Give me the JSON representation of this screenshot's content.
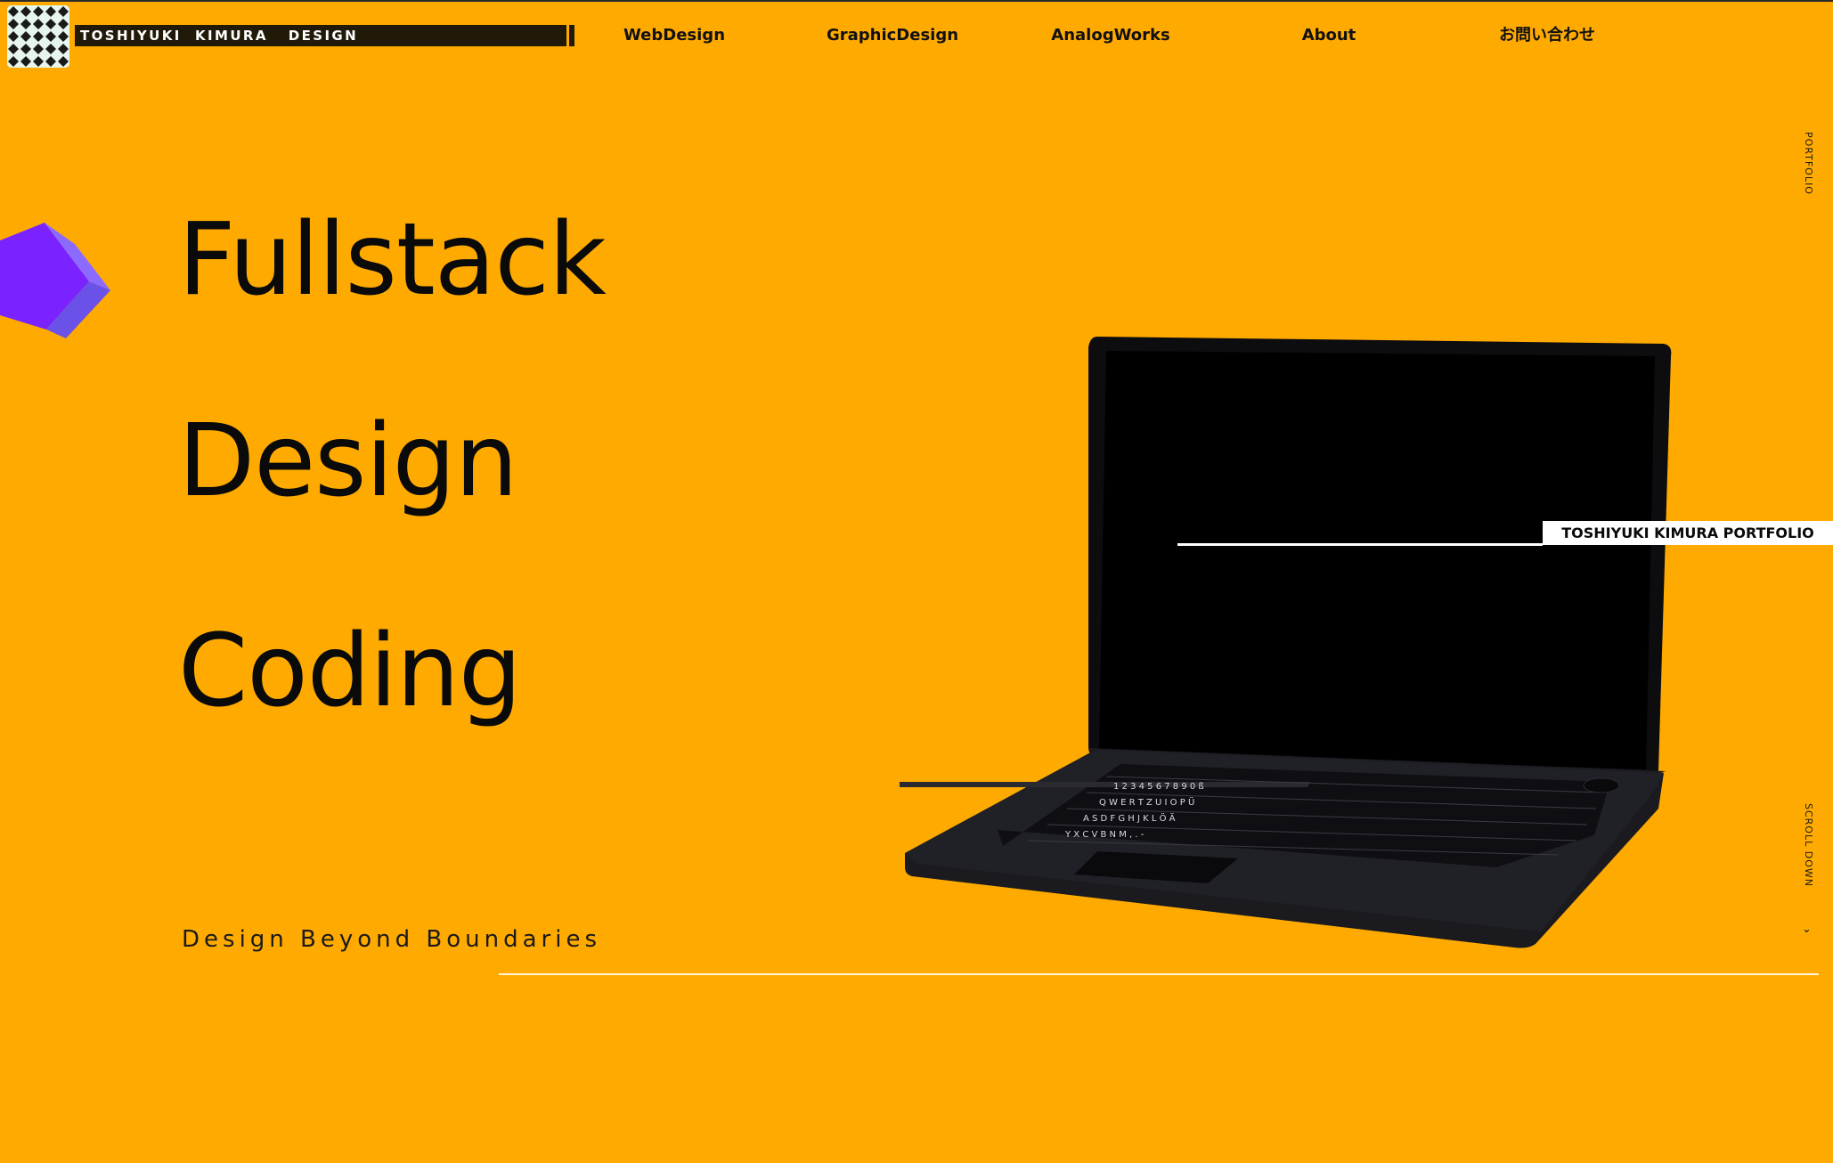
{
  "brand": {
    "logo_text": "TOSHIYUKI  KIMURA   DESIGN",
    "accent": "#FFAA00",
    "logo_icon": "geometric-pattern-icon"
  },
  "nav": {
    "items": [
      {
        "label": "WebDesign"
      },
      {
        "label": "GraphicDesign"
      },
      {
        "label": "AnalogWorks"
      },
      {
        "label": "About"
      },
      {
        "label": "お問い合わせ"
      }
    ]
  },
  "hero": {
    "lines": [
      "Fullstack",
      "Design",
      "Coding"
    ],
    "tagline": "Design Beyond Boundaries"
  },
  "laptop": {
    "icon": "laptop-3d-illustration",
    "badge": "TOSHIYUKI KIMURA PORTFOLIO"
  },
  "side": {
    "top_label": "PORTFOLIO",
    "scroll_label": "SCROLL  DOWN",
    "scroll_icon": "chevron-down-icon"
  },
  "colors": {
    "background": "#FFAA00",
    "cube": "#7A22FF",
    "text": "#0a0a0a"
  }
}
